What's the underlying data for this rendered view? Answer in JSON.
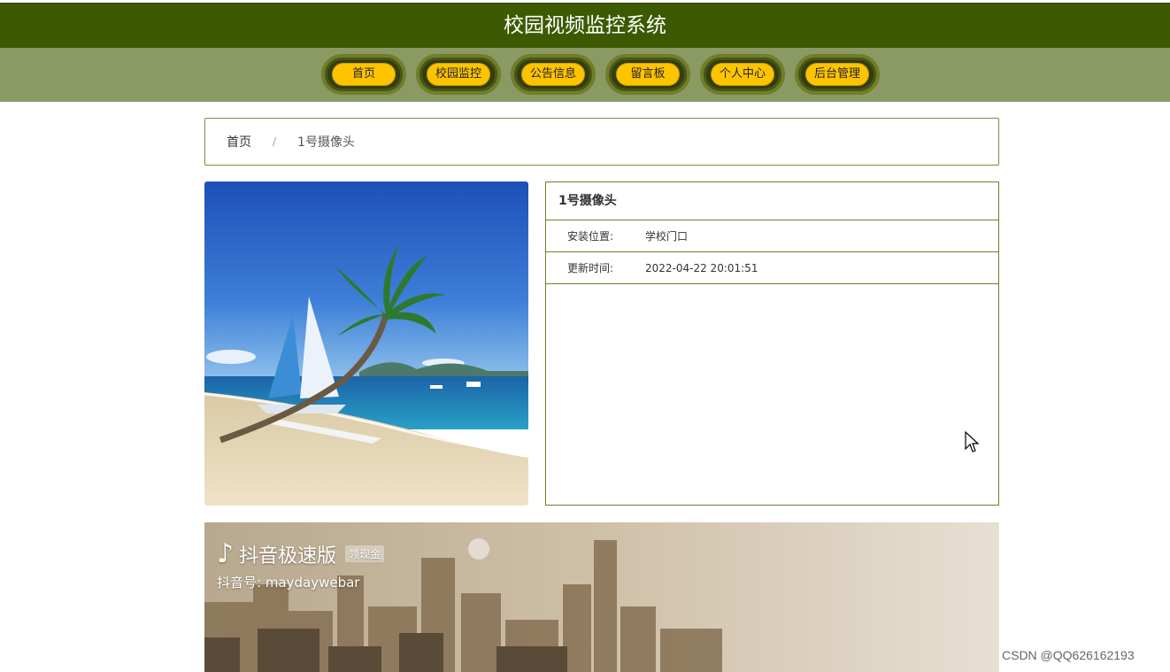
{
  "header": {
    "title": "校园视频监控系统"
  },
  "nav": {
    "items": [
      {
        "label": "首页"
      },
      {
        "label": "校园监控"
      },
      {
        "label": "公告信息"
      },
      {
        "label": "留言板"
      },
      {
        "label": "个人中心"
      },
      {
        "label": "后台管理"
      }
    ]
  },
  "breadcrumb": {
    "home": "首页",
    "separator": "/",
    "current": "1号摄像头"
  },
  "camera": {
    "name": "1号摄像头",
    "location_label": "安装位置:",
    "location_value": "学校门口",
    "updated_label": "更新时间:",
    "updated_value": "2022-04-22 20:01:51"
  },
  "video": {
    "app_name": "抖音极速版",
    "badge": "领现金",
    "account": "抖音号: maydaywebar"
  },
  "watermark": "CSDN @QQ626162193",
  "colors": {
    "title_bar": "#3d5a03",
    "nav_bar": "#8b9a63",
    "nav_button": "#ffc400",
    "border": "#6b8225"
  }
}
